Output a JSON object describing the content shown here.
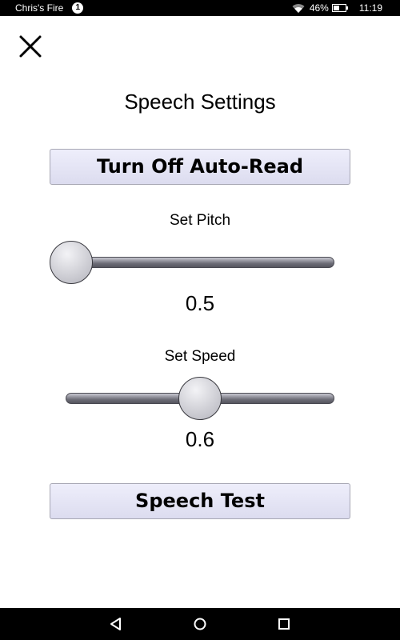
{
  "status_bar": {
    "device_name": "Chris's Fire",
    "notification_count": "1",
    "battery_percent": "46%",
    "time": "11:19"
  },
  "close": {
    "icon": "close-icon"
  },
  "title": "Speech Settings",
  "auto_read_button": "Turn Off Auto-Read",
  "pitch": {
    "label": "Set Pitch",
    "value": "0.5",
    "position_fraction": 0.0
  },
  "speed": {
    "label": "Set Speed",
    "value": "0.6",
    "position_fraction": 0.5
  },
  "speech_test_button": "Speech Test",
  "nav": {
    "back_icon": "back-icon",
    "home_icon": "home-icon",
    "recent_icon": "recent-apps-icon"
  }
}
